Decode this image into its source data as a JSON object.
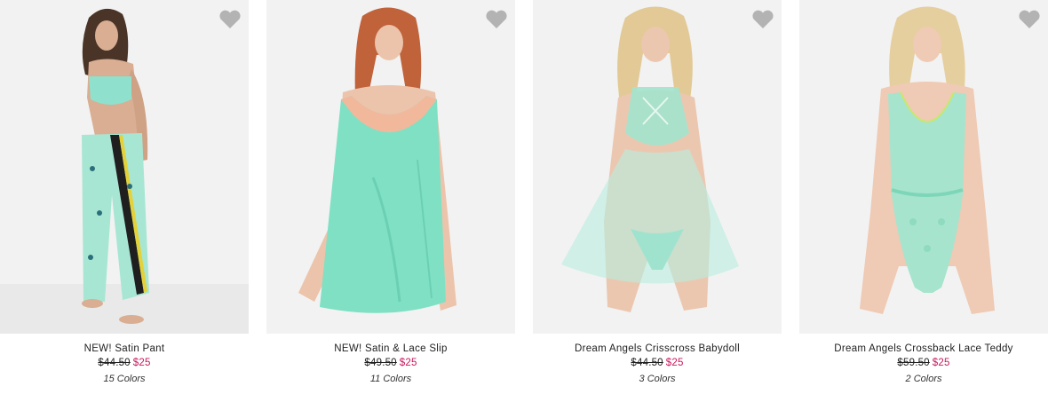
{
  "products": [
    {
      "name": "NEW! Satin Pant",
      "original_price": "$44.50",
      "sale_price": "$25",
      "colors": "15 Colors",
      "favorite_icon": "heart-icon"
    },
    {
      "name": "NEW! Satin & Lace Slip",
      "original_price": "$49.50",
      "sale_price": "$25",
      "colors": "11 Colors",
      "favorite_icon": "heart-icon"
    },
    {
      "name": "Dream Angels Crisscross Babydoll",
      "original_price": "$44.50",
      "sale_price": "$25",
      "colors": "3 Colors",
      "favorite_icon": "heart-icon"
    },
    {
      "name": "Dream Angels Crossback Lace Teddy",
      "original_price": "$59.50",
      "sale_price": "$25",
      "colors": "2 Colors",
      "favorite_icon": "heart-icon"
    }
  ],
  "colors": {
    "sale": "#c8175d",
    "heart": "#b3b3b3",
    "photo_bg": "#f2f2f2",
    "garment_mint": "#9fe3cf"
  }
}
